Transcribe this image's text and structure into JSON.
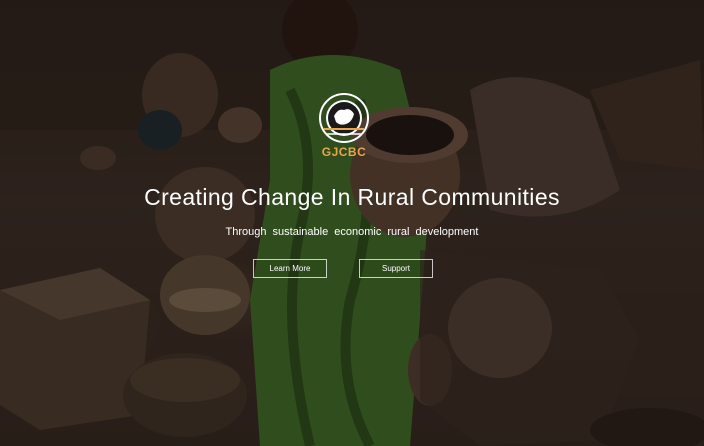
{
  "hero": {
    "logo_text": "GJCBC",
    "headline": "Creating Change In Rural Communities",
    "subline": "Through sustainable economic rural development"
  },
  "buttons": {
    "learn_more": "Learn More",
    "support": "Support"
  },
  "colors": {
    "logo_accent": "#e8a64a",
    "text": "#ffffff",
    "overlay": "#0a0806"
  }
}
